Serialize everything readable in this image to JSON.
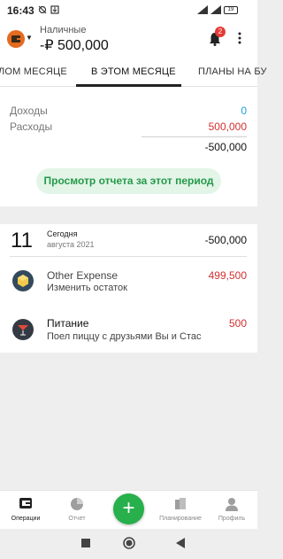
{
  "status_bar": {
    "time": "16:43",
    "battery": "19"
  },
  "header": {
    "account_name": "Наличные",
    "account_balance": "-₽ 500,000",
    "notification_count": "2"
  },
  "tabs": [
    {
      "label": "ЛОМ МЕСЯЦЕ"
    },
    {
      "label": "В ЭТОМ МЕСЯЦЕ"
    },
    {
      "label": "ПЛАНЫ НА БУ"
    }
  ],
  "summary": {
    "income_label": "Доходы",
    "income_value": "0",
    "expense_label": "Расходы",
    "expense_value": "500,000",
    "total_value": "-500,000",
    "report_button": "Просмотр отчета за этот период",
    "colors": {
      "income": "#1e9ed8",
      "expense": "#d32f2f",
      "accent": "#25994a"
    }
  },
  "day_group": {
    "day_number": "11",
    "day_label": "Сегодня",
    "month_year": "августа 2021",
    "day_total": "-500,000"
  },
  "transactions": [
    {
      "title": "Other Expense",
      "subtitle": "Изменить остаток",
      "amount": "499,500",
      "icon": "coins-icon"
    },
    {
      "title": "Питание",
      "subtitle": "Поел пиццу с друзьями Вы и Стас",
      "amount": "500",
      "icon": "cocktail-icon"
    }
  ],
  "bottom_nav": [
    {
      "label": "Операции",
      "icon": "wallet-icon"
    },
    {
      "label": "Отчет",
      "icon": "pie-chart-icon"
    },
    {
      "label": "Планирование",
      "icon": "planning-icon"
    },
    {
      "label": "Профиль",
      "icon": "profile-icon"
    }
  ],
  "fab": {
    "label": "+"
  }
}
